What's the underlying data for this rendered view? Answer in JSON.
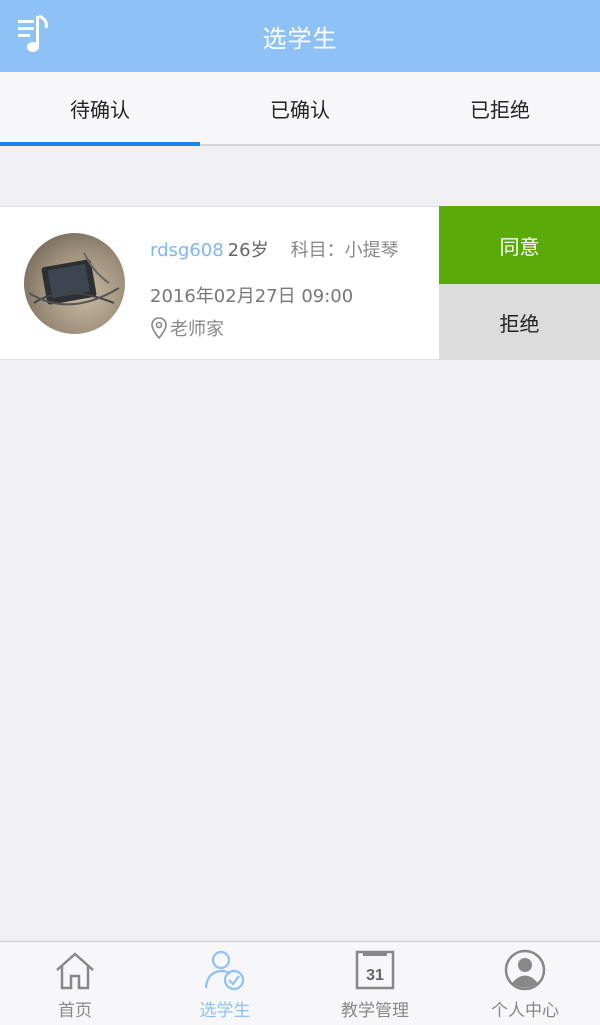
{
  "header": {
    "title": "选学生",
    "menu_icon": "music-list-icon"
  },
  "tabs": [
    {
      "label": "待确认",
      "active": true
    },
    {
      "label": "已确认",
      "active": false
    },
    {
      "label": "已拒绝",
      "active": false
    }
  ],
  "request": {
    "username": "rdsg608",
    "age": "26岁",
    "subject": "科目：小提琴",
    "datetime": "2016年02月27日 09:00",
    "location": "老师家",
    "agree_label": "同意",
    "reject_label": "拒绝"
  },
  "bottom_nav": [
    {
      "label": "首页",
      "icon": "home-icon",
      "active": false
    },
    {
      "label": "选学生",
      "icon": "select-student-icon",
      "active": true
    },
    {
      "label": "教学管理",
      "icon": "calendar-icon",
      "calendar_day": "31",
      "active": false
    },
    {
      "label": "个人中心",
      "icon": "user-icon",
      "active": false
    }
  ],
  "colors": {
    "header_bg": "#8ec1f5",
    "tab_indicator": "#1e86e8",
    "agree_bg": "#5aab0a",
    "reject_bg": "#dcdcdc",
    "username": "#7fb6ee"
  }
}
